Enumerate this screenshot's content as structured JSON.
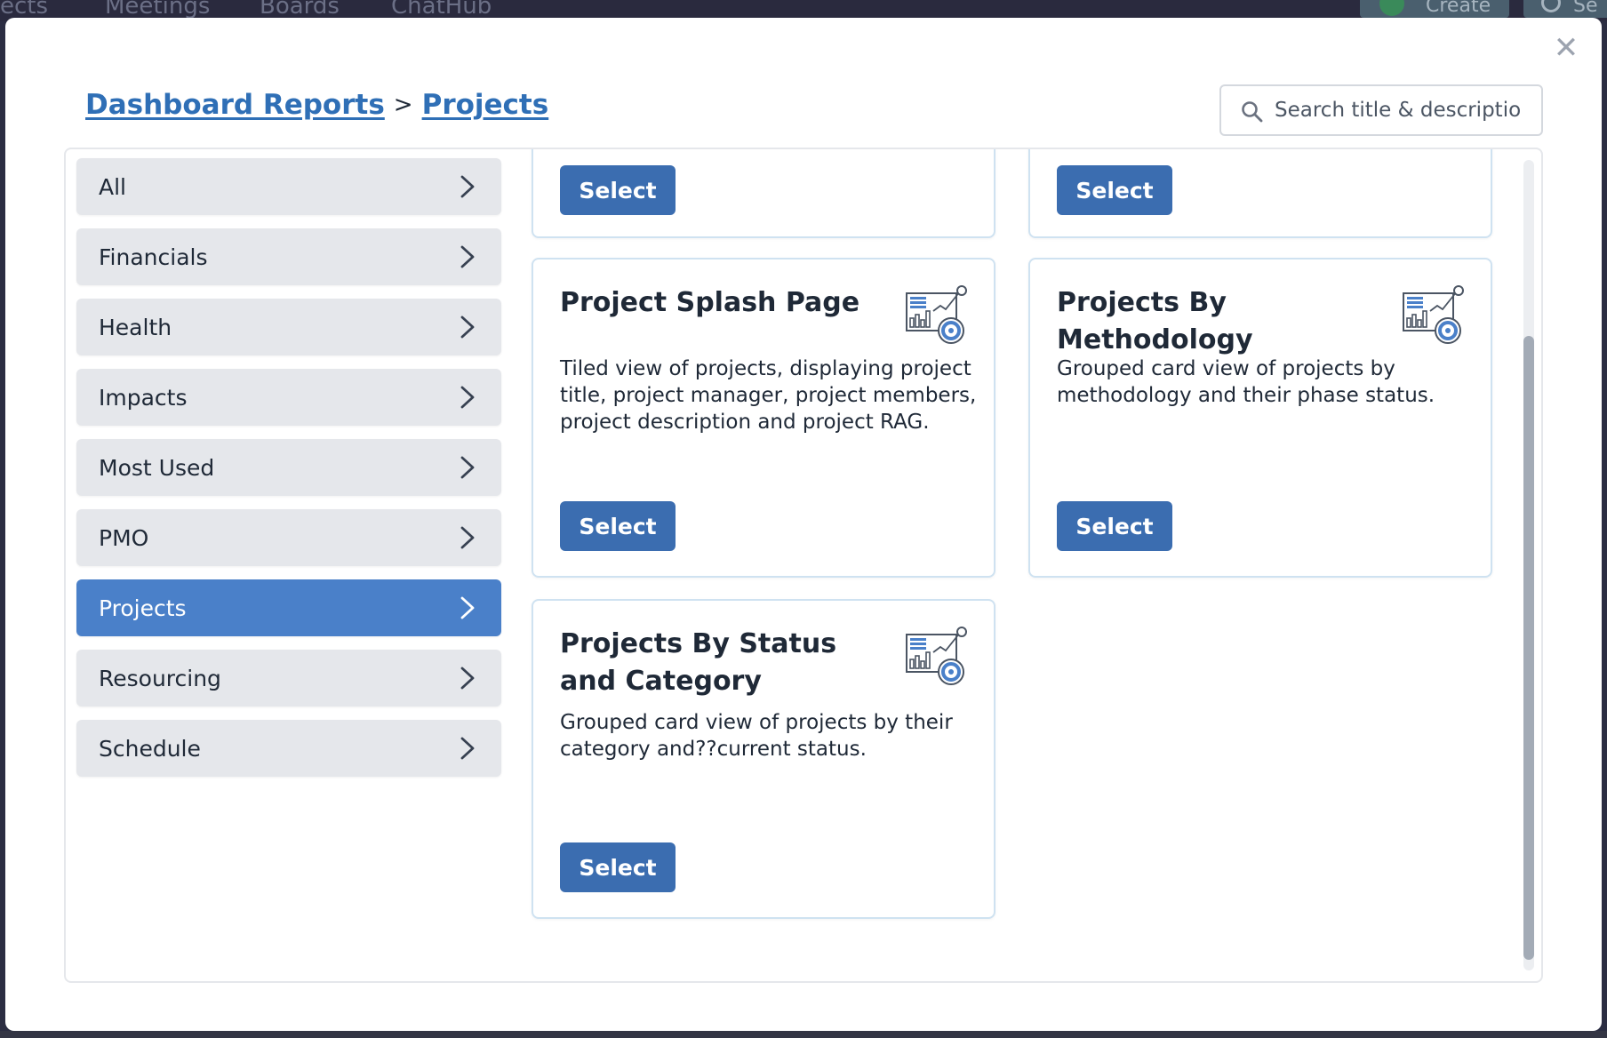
{
  "background_nav": {
    "items": [
      "ects",
      "Meetings",
      "Boards",
      "ChatHub"
    ],
    "create_label": "Create",
    "search_label": "Se"
  },
  "modal": {
    "close_icon": "close-icon",
    "breadcrumb": {
      "root": "Dashboard Reports",
      "separator": ">",
      "current": "Projects"
    },
    "search": {
      "placeholder": "Search title & descriptio",
      "value": ""
    },
    "categories": [
      {
        "label": "All",
        "active": false
      },
      {
        "label": "Financials",
        "active": false
      },
      {
        "label": "Health",
        "active": false
      },
      {
        "label": "Impacts",
        "active": false
      },
      {
        "label": "Most Used",
        "active": false
      },
      {
        "label": "PMO",
        "active": false
      },
      {
        "label": "Projects",
        "active": true
      },
      {
        "label": "Resourcing",
        "active": false
      },
      {
        "label": "Schedule",
        "active": false
      }
    ],
    "cards": [
      {
        "title": "",
        "description": "",
        "button": "Select"
      },
      {
        "title": "",
        "description": "",
        "button": "Select"
      },
      {
        "title": "Project Splash Page",
        "description": "Tiled view of projects, displaying project title, project manager, project members, project description and project RAG.",
        "button": "Select",
        "icon": "report-chart-icon"
      },
      {
        "title": "Projects By Methodology",
        "description": "Grouped card view of projects by methodology and their phase status.",
        "button": "Select",
        "icon": "report-chart-icon"
      },
      {
        "title": "Projects By Status and Category",
        "description": "Grouped card view of projects by their category and??current status.",
        "button": "Select",
        "icon": "report-chart-icon"
      }
    ],
    "colors": {
      "accent": "#3b6db0",
      "active_category": "#4a80c9",
      "link": "#2f6fb6",
      "card_border": "#cfe2f1"
    }
  }
}
